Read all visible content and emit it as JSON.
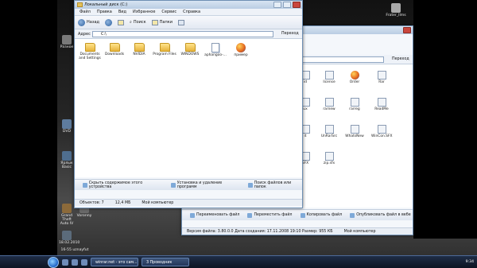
{
  "desktop": {
    "icons": [
      {
        "label": "Разное",
        "x": "ignore"
      },
      {
        "label": "DVD"
      },
      {
        "label": "Ярлык Basic"
      },
      {
        "label": "Grand Theft Auto IV"
      },
      {
        "label": "Voronny"
      },
      {
        "label": "18.02.2010"
      },
      {
        "label": "16-55 uznayfut"
      },
      {
        "label": "Frater_Ilms"
      }
    ]
  },
  "front_window": {
    "title": "Локальный диск (C:)",
    "menu": [
      "Файл",
      "Правка",
      "Вид",
      "Избранное",
      "Сервис",
      "Справка"
    ],
    "toolbar": {
      "back": "Назад",
      "search": "Поиск",
      "folders": "Папки"
    },
    "address": {
      "label": "Адрес",
      "value": "C:\\",
      "go": "Переход"
    },
    "items": [
      {
        "label": "Documents and Settings",
        "type": "folder"
      },
      {
        "label": "Downloads",
        "type": "folder"
      },
      {
        "label": "NVIDIA",
        "type": "folder"
      },
      {
        "label": "Program Files",
        "type": "folder"
      },
      {
        "label": "WINDOWS",
        "type": "folder"
      },
      {
        "label": "aphangoo-...",
        "type": "file"
      },
      {
        "label": "пример",
        "type": "firefox"
      }
    ],
    "tasks": [
      "Скрыть содержимое этого устройства",
      "Установка и удаление программ",
      "Поиск файлов или папок"
    ],
    "status": {
      "objects": "Объектов: 7",
      "size": "12,4 МБ",
      "location": "Мой компьютер"
    }
  },
  "back_window": {
    "go": "Переход",
    "items": [
      {
        "label": "id"
      },
      {
        "label": "license"
      },
      {
        "label": "Order"
      },
      {
        "label": "Rar"
      },
      {
        "label": "ux"
      },
      {
        "label": "rarnew"
      },
      {
        "label": "rarreg"
      },
      {
        "label": "ReadMe"
      },
      {
        "label": "it"
      },
      {
        "label": "UnRarSrc"
      },
      {
        "label": "WhatsNew"
      },
      {
        "label": "WinCon.SFX"
      },
      {
        "label": "SFX"
      },
      {
        "label": "zip.sfx"
      }
    ],
    "tasks": [
      "Переименовать файл",
      "Переместить файл",
      "Копировать файл",
      "Опубликовать файл в вебе"
    ],
    "status": {
      "version": "Версия файла: 3.80.0.0 Дата создания: 17.11.2008 19:10 Размер: 955 КБ",
      "size": "955 КБ",
      "location": "Мой компьютер"
    }
  },
  "taskbar": {
    "apps": [
      "winrar.net - это сам...",
      "3 Проводник"
    ],
    "time": "9:34"
  }
}
